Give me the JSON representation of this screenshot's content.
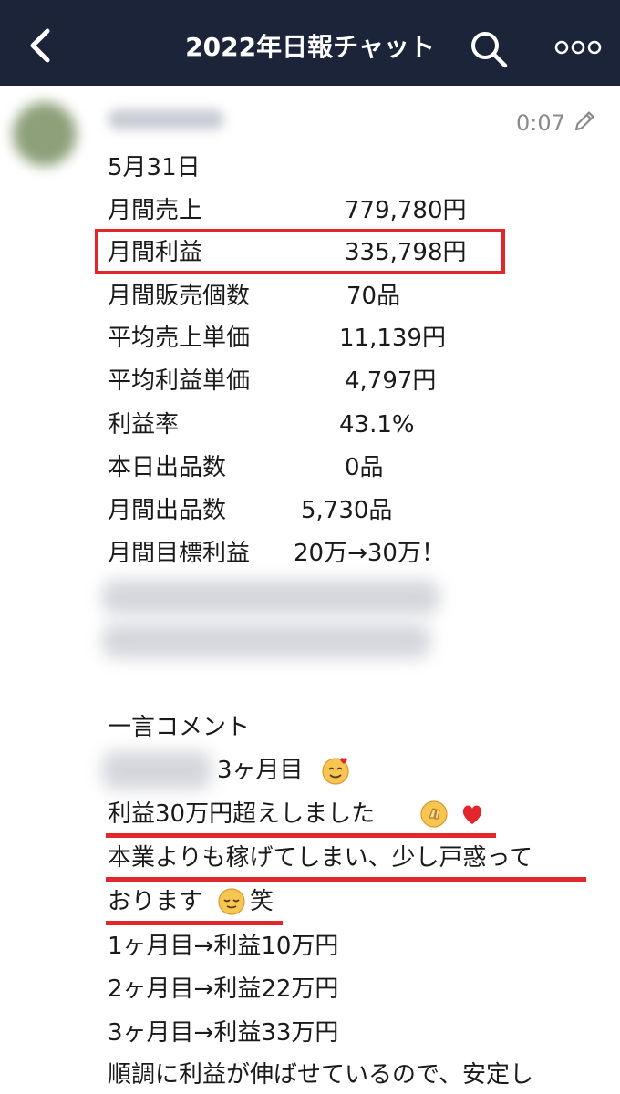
{
  "header": {
    "title": "2022年日報チャット",
    "bg_color": "#1b2438"
  },
  "message": {
    "time": "0:07",
    "date": "5月31日",
    "stats": [
      {
        "label": "月間売上",
        "value": "779,780円"
      },
      {
        "label": "月間利益",
        "value": "335,798円"
      },
      {
        "label": "月間販売個数",
        "value": "70品"
      },
      {
        "label": "平均売上単価",
        "value": "11,139円"
      },
      {
        "label": "平均利益単価",
        "value": "4,797円"
      },
      {
        "label": "利益率",
        "value": "43.1%"
      },
      {
        "label": "本日出品数",
        "value": "0品"
      },
      {
        "label": "月間出品数",
        "value": "5,730品"
      },
      {
        "label": "月間目標利益",
        "value": "20万→30万！"
      }
    ],
    "comment_heading": "一言コメント",
    "comment_line1_suffix": "3ヶ月目",
    "comment_line2": "利益30万円超えしました",
    "comment_line3": "本業よりも稼げてしまい、少し戸惑って",
    "comment_line4": "おります",
    "comment_line4_tail": "笑",
    "progress": [
      "1ヶ月目→利益10万円",
      "2ヶ月目→利益22万円",
      "3ヶ月目→利益33万円"
    ],
    "last_line": "順調に利益が伸ばせているので、安定し"
  },
  "icons": {
    "back": "chevron-left-icon",
    "search": "search-icon",
    "more": "more-dots-icon",
    "edit": "pencil-icon"
  },
  "colors": {
    "highlight_red": "#e3262b",
    "time_gray": "#8a8a8a"
  }
}
